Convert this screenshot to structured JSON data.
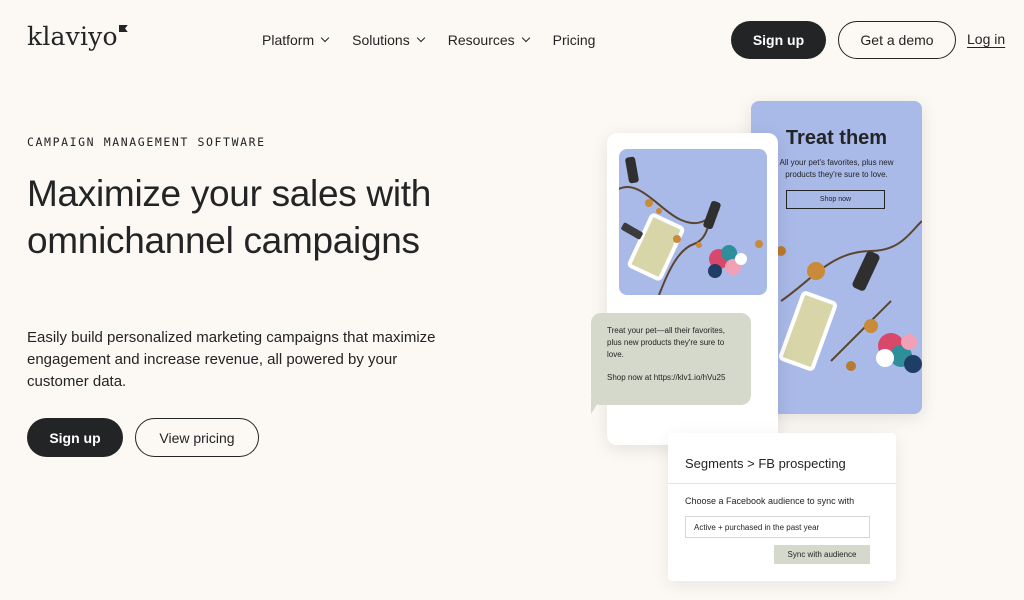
{
  "header": {
    "logo_text": "klaviyo",
    "nav": [
      {
        "label": "Platform",
        "has_dropdown": true
      },
      {
        "label": "Solutions",
        "has_dropdown": true
      },
      {
        "label": "Resources",
        "has_dropdown": true
      },
      {
        "label": "Pricing",
        "has_dropdown": false
      }
    ],
    "signup_label": "Sign up",
    "demo_label": "Get a demo",
    "login_label": "Log in"
  },
  "hero": {
    "eyebrow": "CAMPAIGN MANAGEMENT SOFTWARE",
    "headline": "Maximize your sales with omnichannel campaigns",
    "subtext": "Easily build personalized marketing campaigns that maximize engagement and increase revenue, all powered by your customer data.",
    "signup_label": "Sign up",
    "pricing_label": "View pricing"
  },
  "illustration": {
    "email_card": {
      "title": "Treat them",
      "description": "All your pet's favorites, plus new products they're sure to love.",
      "button_label": "Shop now"
    },
    "sms": {
      "message": "Treat your pet—all their favorites, plus new products they're sure to love.",
      "link_text": "Shop now at https://klv1.io/hVu25"
    },
    "segment_panel": {
      "title": "Segments > FB prospecting",
      "label": "Choose a Facebook audience to sync with",
      "input_value": "Active + purchased in the past year",
      "button_label": "Sync with audience"
    }
  },
  "colors": {
    "background": "#fcf8f3",
    "dark": "#232426",
    "card_blue": "#a9b9e8",
    "sage": "#d4d9cb"
  }
}
